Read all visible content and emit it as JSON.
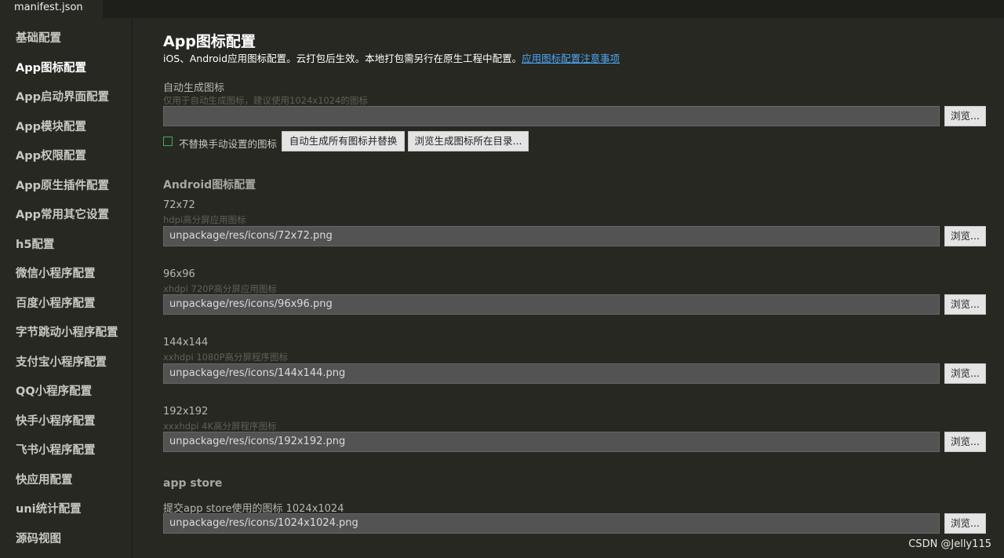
{
  "tab": {
    "label": "manifest.json"
  },
  "sidebar": {
    "items": [
      {
        "label": "基础配置"
      },
      {
        "label": "App图标配置"
      },
      {
        "label": "App启动界面配置"
      },
      {
        "label": "App模块配置"
      },
      {
        "label": "App权限配置"
      },
      {
        "label": "App原生插件配置"
      },
      {
        "label": "App常用其它设置"
      },
      {
        "label": "h5配置"
      },
      {
        "label": "微信小程序配置"
      },
      {
        "label": "百度小程序配置"
      },
      {
        "label": "字节跳动小程序配置"
      },
      {
        "label": "支付宝小程序配置"
      },
      {
        "label": "QQ小程序配置"
      },
      {
        "label": "快手小程序配置"
      },
      {
        "label": "飞书小程序配置"
      },
      {
        "label": "快应用配置"
      },
      {
        "label": "uni统计配置"
      },
      {
        "label": "源码视图"
      }
    ],
    "active": "App图标配置"
  },
  "page": {
    "title": "App图标配置",
    "desc": "iOS、Android应用图标配置。云打包后生效。本地打包需另行在原生工程中配置。",
    "link": "应用图标配置注意事项"
  },
  "auto": {
    "label": "自动生成图标",
    "hint": "仅用于自动生成图标，建议使用1024x1024的图标",
    "value": "",
    "browse": "浏览...",
    "checkbox_label": "不替换手动设置的图标",
    "checked": false,
    "gen_button": "自动生成所有图标并替换",
    "open_dir_button": "浏览生成图标所在目录..."
  },
  "android": {
    "title": "Android图标配置",
    "icons": [
      {
        "label": "72x72",
        "hint": "hdpi高分屏应用图标",
        "value": "unpackage/res/icons/72x72.png",
        "browse": "浏览..."
      },
      {
        "label": "96x96",
        "hint": "xhdpi 720P高分屏应用图标",
        "value": "unpackage/res/icons/96x96.png",
        "browse": "浏览..."
      },
      {
        "label": "144x144",
        "hint": "xxhdpi 1080P高分屏程序图标",
        "value": "unpackage/res/icons/144x144.png",
        "browse": "浏览..."
      },
      {
        "label": "192x192",
        "hint": "xxxhdpi 4K高分屏程序图标",
        "value": "unpackage/res/icons/192x192.png",
        "browse": "浏览..."
      }
    ]
  },
  "appstore": {
    "title": "app store",
    "label": "提交app store使用的图标 1024x1024",
    "value": "unpackage/res/icons/1024x1024.png",
    "browse": "浏览..."
  },
  "watermark": "CSDN @Jelly115",
  "colors": {
    "background": "#272822",
    "link": "#4ea6f5",
    "checkbox": "#3fae60"
  }
}
